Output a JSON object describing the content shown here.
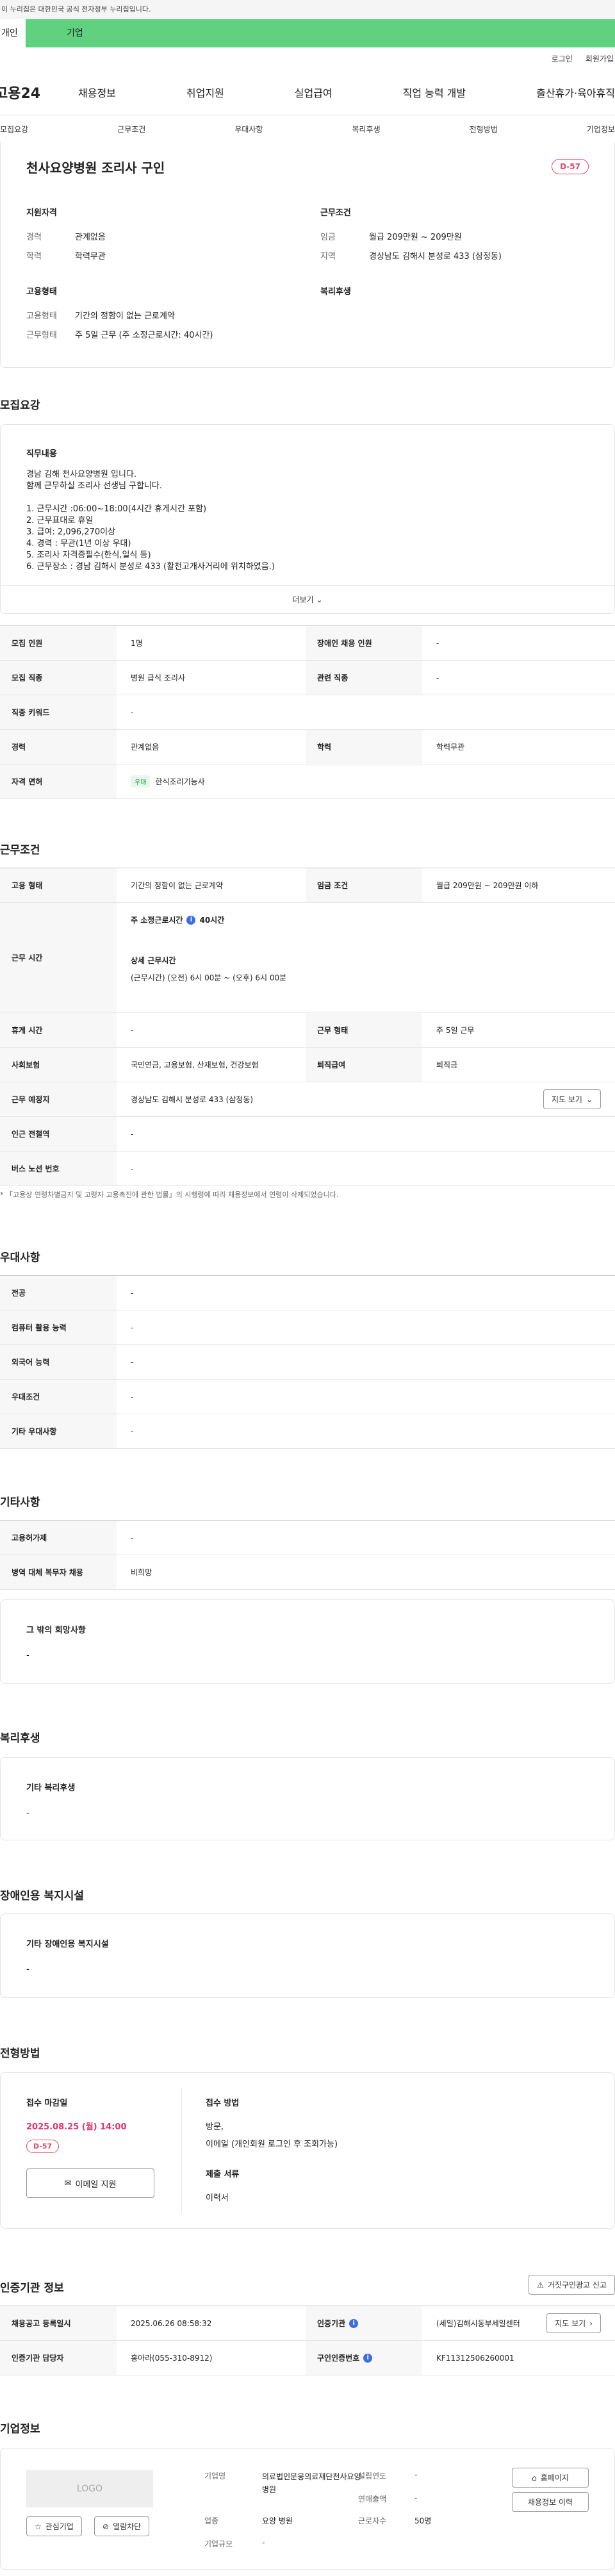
{
  "gov": "이 누리집은 대한민국 공식 전자정부 누리집입니다.",
  "tabs": {
    "personal": "개인",
    "company": "기업"
  },
  "util": {
    "login": "로그인",
    "join": "회원가입"
  },
  "gnb": {
    "logo": "고용24",
    "menu": [
      "채용정보",
      "취업지원",
      "실업급여",
      "직업 능력 개발",
      "출산휴가·육아휴직"
    ]
  },
  "anchor": [
    "모집요강",
    "근무조건",
    "우대사항",
    "복리후생",
    "전형방법",
    "기업정보"
  ],
  "job": {
    "title": "천사요양병원 조리사 구인",
    "dday": "D-57",
    "qual": {
      "title": "지원자격",
      "rows": [
        {
          "k": "경력",
          "v": "관계없음"
        },
        {
          "k": "학력",
          "v": "학력무관"
        }
      ]
    },
    "cond": {
      "title": "근무조건",
      "rows": [
        {
          "k": "임금",
          "v": "월급 209만원 ~ 209만원"
        },
        {
          "k": "지역",
          "v": "경상남도 김해시 분성로 433 (삼정동)"
        }
      ]
    },
    "emp": {
      "title": "고용형태",
      "rows": [
        {
          "k": "고용형태",
          "v": "기간의 정함이 없는 근로계약"
        },
        {
          "k": "근무형태",
          "v": "주 5일 근무 (주 소정근로시간: 40시간)"
        }
      ]
    },
    "welfare": {
      "title": "복리후생"
    }
  },
  "recruit": {
    "title": "모집요강",
    "duty_title": "직무내용",
    "duty_lines": [
      "경남 김해 천사요양병원 입니다.",
      "함께 근무하실 조리사 선생님 구합니다.",
      "",
      "1. 근무시간 :06:00~18:00(4시간 휴게시간 포함)",
      "2. 근무표대로 휴일",
      "3. 급여: 2,096,270이상",
      "4. 경력 : 무관(1년 이상 우대)",
      "5. 조리사 자격증필수(한식,일식 등)",
      "6. 근무장소 : 경남 김해시 분성로 433 (활천고개사거리에 위치하였음.)"
    ],
    "more": "더보기",
    "rows": [
      {
        "k1": "모집 인원",
        "v1": "1명",
        "k2": "장애인 채용 인원",
        "v2": "-"
      },
      {
        "k1": "모집 직종",
        "v1": "병원 급식 조리사",
        "k2": "관련 직종",
        "v2": "-"
      },
      {
        "k1": "직종 키워드",
        "v1": "-"
      },
      {
        "k1": "경력",
        "v1": "관계없음",
        "k2": "학력",
        "v2": "학력무관"
      },
      {
        "k1": "자격 면허",
        "badge": "우대",
        "v1": "한식조리기능사"
      }
    ]
  },
  "work": {
    "title": "근무조건",
    "type_k": "고용 형태",
    "type_v": "기간의 정함이 없는 근로계약",
    "wage_k": "임금 조건",
    "wage_v": "월급 209만원 ~ 209만원 이하",
    "time_k": "근무 시간",
    "time_main": "주 소정근로시간",
    "time_hours": "40시간",
    "time_detail_title": "상세 근무시간",
    "time_detail": "(근무시간) (오전) 6시 00분 ~ (오후) 6시 00분",
    "rows": [
      {
        "k1": "휴게 시간",
        "v1": "-",
        "k2": "근무 형태",
        "v2": "주 5일 근무"
      },
      {
        "k1": "사회보험",
        "v1": "국민연금, 고용보험, 산재보험, 건강보험",
        "k2": "퇴직급여",
        "v2": "퇴직금"
      }
    ],
    "place_k": "근무 예정지",
    "place_v": "경상남도 김해시 분성로 433 (삼정동)",
    "map_btn": "지도 보기",
    "near_k": "인근 전철역",
    "near_v": "-",
    "bus_k": "버스 노선 번호",
    "bus_v": "-",
    "note": "「고용상 연령차별금지 및 고령자 고용촉진에 관한 법률」의 시행령에 따라 채용정보에서 연령이 삭제되었습니다."
  },
  "pref": {
    "title": "우대사항",
    "rows": [
      {
        "k": "전공",
        "v": "-"
      },
      {
        "k": "컴퓨터 활용 능력",
        "v": "-"
      },
      {
        "k": "외국어 능력",
        "v": "-"
      },
      {
        "k": "우대조건",
        "v": "-"
      },
      {
        "k": "기타 우대사항",
        "v": "-"
      }
    ]
  },
  "etc": {
    "title": "기타사항",
    "rows": [
      {
        "k": "고용허가제",
        "v": "-"
      },
      {
        "k": "병역 대체 복무자 채용",
        "v": "비희망"
      }
    ],
    "hope_title": "그 밖의 희망사항",
    "hope_v": "-"
  },
  "benefit": {
    "title": "복리후생",
    "card_title": "기타 복리후생",
    "card_v": "-"
  },
  "disab": {
    "title": "장애인용 복지시설",
    "card_title": "기타 장애인용 복지시설",
    "card_v": "-"
  },
  "select": {
    "title": "전형방법",
    "deadline_label": "접수 마감일",
    "deadline": "2025.08.25 (월) 14:00",
    "dday": "D-57",
    "apply_btn": "이메일 지원",
    "method_label": "접수 방법",
    "method_v1": "방문,",
    "method_v2": "이메일 (개인회원 로그인 후 조회가능)",
    "docs_label": "제출 서류",
    "docs_v": "이력서"
  },
  "agency": {
    "title": "인증기관 정보",
    "report_btn": "거짓구인광고 신고",
    "rows": [
      {
        "k1": "채용공고 등록일시",
        "v1": "2025.06.26 08:58:32",
        "k2": "인증기관",
        "v2": "(세일)김해시동부세일센터",
        "btn": "지도 보기"
      },
      {
        "k1": "인증기관 담당자",
        "v1": "홍아라(055-310-8912)",
        "k2": "구인인증번호",
        "v2": "KF11312506260001"
      }
    ]
  },
  "company": {
    "title": "기업정보",
    "logo": "LOGO",
    "fav_btn": "관심기업",
    "block_btn": "열람차단",
    "name_k": "기업명",
    "name_v": "의료법인문웅의료재단천사요양병원",
    "found_k": "설립연도",
    "found_v": "-",
    "sales_k": "연매출액",
    "sales_v": "-",
    "ind_k": "업종",
    "ind_v": "요양 병원",
    "emp_k": "근로자수",
    "emp_v": "50명",
    "size_k": "기업규모",
    "size_v": "-",
    "home_btn": "홈페이지",
    "jobs_btn": "채용정보 이력"
  }
}
